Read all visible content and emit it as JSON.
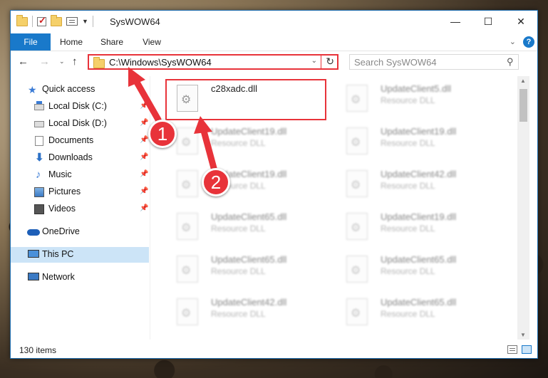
{
  "window": {
    "title": "SysWOW64",
    "controls": {
      "minimize": "—",
      "maximize": "☐",
      "close": "✕"
    }
  },
  "ribbon": {
    "tabs": [
      "File",
      "Home",
      "Share",
      "View"
    ],
    "help": "?"
  },
  "address": {
    "path": "C:\\Windows\\SysWOW64",
    "search_placeholder": "Search SysWOW64"
  },
  "navpane": {
    "quick_access": "Quick access",
    "items": [
      {
        "label": "Local Disk (C:)",
        "pinned": true
      },
      {
        "label": "Local Disk (D:)",
        "pinned": true
      },
      {
        "label": "Documents",
        "pinned": true
      },
      {
        "label": "Downloads",
        "pinned": true
      },
      {
        "label": "Music",
        "pinned": true
      },
      {
        "label": "Pictures",
        "pinned": true
      },
      {
        "label": "Videos",
        "pinned": true
      }
    ],
    "onedrive": "OneDrive",
    "this_pc": "This PC",
    "network": "Network"
  },
  "files": {
    "highlighted": {
      "name": "c28xadc.dll"
    },
    "blurred": [
      {
        "name": "UpdateClient5.dll",
        "type": "Resource DLL"
      },
      {
        "name": "UpdateClient19.dll",
        "type": "Resource DLL"
      },
      {
        "name": "UpdateClient19.dll",
        "type": "Resource DLL"
      },
      {
        "name": "UpdateClient19.dll",
        "type": "Resource DLL"
      },
      {
        "name": "UpdateClient42.dll",
        "type": "Resource DLL"
      },
      {
        "name": "UpdateClient65.dll",
        "type": "Resource DLL"
      },
      {
        "name": "UpdateClient19.dll",
        "type": "Resource DLL"
      },
      {
        "name": "UpdateClient65.dll",
        "type": "Resource DLL"
      },
      {
        "name": "UpdateClient65.dll",
        "type": "Resource DLL"
      },
      {
        "name": "UpdateClient42.dll",
        "type": "Resource DLL"
      },
      {
        "name": "UpdateClient65.dll",
        "type": "Resource DLL"
      }
    ]
  },
  "status": {
    "count": "130 items"
  },
  "annotations": {
    "step1": "1",
    "step2": "2"
  },
  "colors": {
    "accent": "#1979ca",
    "annotation": "#e8333a",
    "selected": "#cce4f7"
  }
}
